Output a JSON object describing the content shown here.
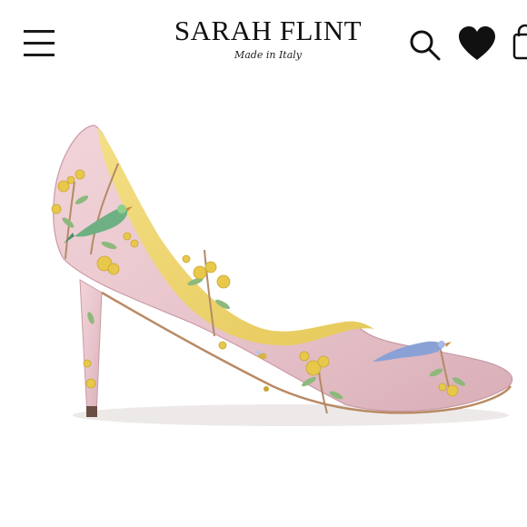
{
  "header": {
    "brand_name": "SARAH FLINT",
    "brand_tagline": "Made in Italy",
    "icons": [
      "menu-icon",
      "search-icon",
      "heart-icon",
      "bag-icon"
    ]
  },
  "product": {
    "image_subject": "pink floral embroidered pointed-toe pump"
  },
  "colors": {
    "shoe_pink": "#e9c9cf",
    "lining_yellow": "#efd56a",
    "flower_yellow": "#e8c84a",
    "leaf_green": "#7fae6e",
    "text": "#111111"
  }
}
